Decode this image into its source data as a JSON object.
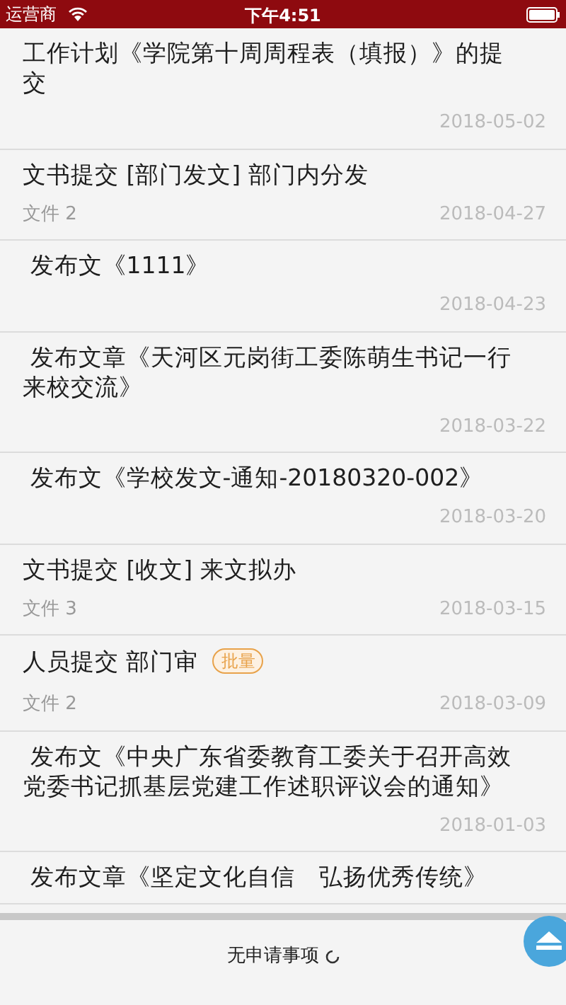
{
  "status_bar": {
    "carrier": "运营商",
    "time": "下午4:51"
  },
  "items": [
    {
      "title": "工作计划《学院第十周周程表（填报）》的提交",
      "date": "2018-05-02"
    },
    {
      "title": "文书提交 [部门发文] 部门内分发",
      "file": "文件 2",
      "date": "2018-04-27"
    },
    {
      "title": " 发布文《1111》",
      "date": "2018-04-23"
    },
    {
      "title": " 发布文章《天河区元岗街工委陈萌生书记一行来校交流》",
      "date": "2018-03-22"
    },
    {
      "title": " 发布文《学校发文-通知-20180320-002》",
      "date": "2018-03-20"
    },
    {
      "title": "文书提交 [收文] 来文拟办",
      "file": "文件 3",
      "date": "2018-03-15"
    },
    {
      "title": "人员提交 部门审",
      "badge": "批量",
      "file": "文件 2",
      "date": "2018-03-09"
    },
    {
      "title": " 发布文《中央广东省委教育工委关于召开高效党委书记抓基层党建工作述职评议会的通知》",
      "date": "2018-01-03"
    },
    {
      "title": " 发布文章《坚定文化自信　弘扬优秀传统》"
    }
  ],
  "footer": {
    "text": "无申请事项"
  }
}
